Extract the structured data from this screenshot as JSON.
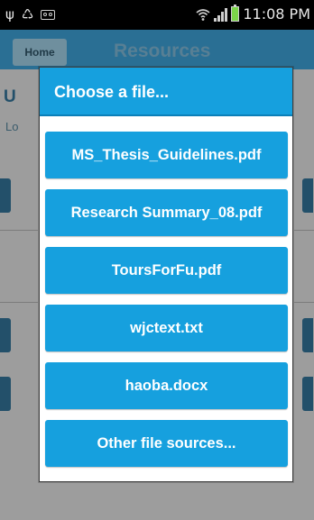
{
  "status_bar": {
    "time": "11:08 PM",
    "icons": [
      "usb-icon",
      "recycle-icon",
      "voicemail-icon",
      "wifi-icon",
      "signal-icon",
      "battery-charging-icon"
    ]
  },
  "background": {
    "home_label": "Home",
    "title": "Resources",
    "partial_heading": "U",
    "partial_label": "Lo"
  },
  "dialog": {
    "title": "Choose a file...",
    "files": [
      "MS_Thesis_Guidelines.pdf",
      "Research Summary_08.pdf",
      "ToursForFu.pdf",
      "wjctext.txt",
      "haoba.docx"
    ],
    "other_label": "Other file sources..."
  },
  "colors": {
    "accent": "#16a0de",
    "accent_dark": "#0b7fb8",
    "overlay_bg": "#9d9d9d"
  }
}
